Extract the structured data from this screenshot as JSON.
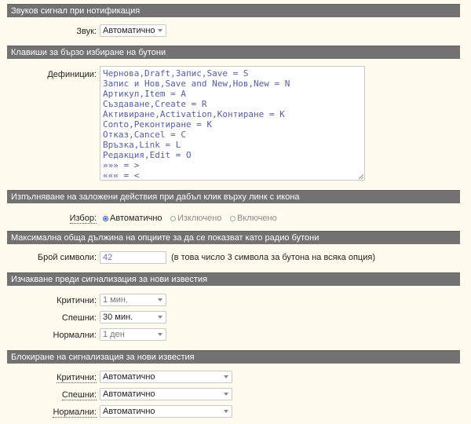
{
  "sections": {
    "sound": "Звуков сигнал при нотификация",
    "shortcuts": "Клавиши за бързо избиране на бутони",
    "dblclick": "Изпълняване на заложени действия при дабъл клик върху линк с икона",
    "maxlen": "Максимална обща дължина на опциите за да се показват като радио бутони",
    "wait": "Изчакване преди сигнализация за нови известия",
    "block": "Блокиране на сигнализация за нови известия"
  },
  "sound": {
    "label": "Звук:",
    "value": "Автоматично"
  },
  "shortcuts": {
    "label": "Дефиниции:",
    "lines": [
      "Чернова,Draft,Запис,Save = S",
      "Запис и Нов,Save and New,Нов,New = N",
      "Артикул,Item = A",
      "Създаване,Create = R",
      "Активиране,Activation,Контиране = K",
      "Conto,Реконтиране = K",
      "Отказ,Cancel = C",
      "Връзка,Link = L",
      "Редакция,Edit = O",
      "»»» = >",
      "««« = <"
    ]
  },
  "dblclick": {
    "label": "Избор:",
    "options": [
      "Автоматично",
      "Изключено",
      "Включено"
    ],
    "selected": "Автоматично"
  },
  "maxlen": {
    "label": "Брой символи:",
    "value": "42",
    "hint": "(в това число 3 символа за бутона на всяка опция)"
  },
  "wait": {
    "critical_label": "Критични:",
    "critical_value": "1 мин.",
    "urgent_label": "Спешни:",
    "urgent_value": "30 мин.",
    "normal_label": "Нормални:",
    "normal_value": "1 ден"
  },
  "block": {
    "critical_label": "Критични:",
    "critical_value": "Автоматично",
    "urgent_label": "Спешни:",
    "urgent_value": "Автоматично",
    "normal_label": "Нормални:",
    "normal_value": "Автоматично"
  }
}
